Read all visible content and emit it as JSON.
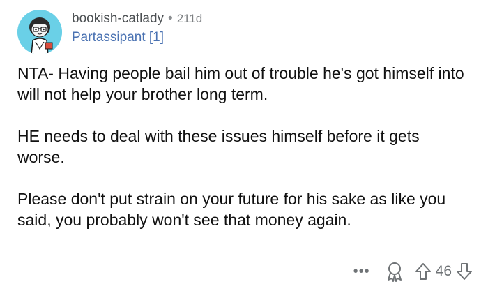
{
  "comment": {
    "author": "bookish-catlady",
    "separator": "•",
    "age": "211d",
    "flair": "Partassipant [1]",
    "paragraphs": [
      "NTA- Having people bail him out of trouble he's got himself into will not help your brother long term.",
      "HE needs to deal with these issues himself before it gets worse.",
      "Please don't put strain on your future for his sake as like you said, you probably won't see that money again."
    ],
    "actions": {
      "more_label": "•••",
      "vote_count": "46"
    }
  },
  "colors": {
    "avatar_background": "#6ad0e7",
    "flair": "#4a72b2",
    "meta": "#6f7376"
  },
  "icons": [
    "avatar-snoo",
    "award-icon",
    "upvote-arrow-icon",
    "downvote-arrow-icon"
  ]
}
